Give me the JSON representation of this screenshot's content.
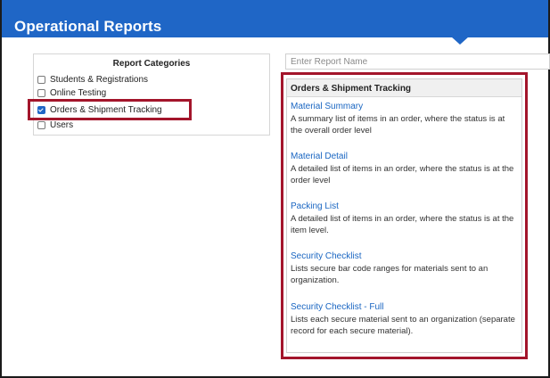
{
  "header": {
    "title": "Operational Reports",
    "color": "#1f66c6"
  },
  "categories": {
    "title": "Report Categories",
    "items": [
      {
        "label": "Students & Registrations",
        "checked": false
      },
      {
        "label": "Online Testing",
        "checked": false
      },
      {
        "label": "Orders & Shipment Tracking",
        "checked": true
      },
      {
        "label": "Users",
        "checked": false
      }
    ]
  },
  "search": {
    "placeholder": "Enter Report Name"
  },
  "reports": {
    "heading": "Orders & Shipment Tracking",
    "items": [
      {
        "name": "Material Summary",
        "description": "A summary list of items in an order, where the status is at the overall order level"
      },
      {
        "name": "Material Detail",
        "description": "A detailed list of items in an order, where the status is at the order level"
      },
      {
        "name": "Packing List",
        "description": "A detailed list of items in an order, where the status is at the item level."
      },
      {
        "name": "Security Checklist",
        "description": "Lists secure bar code ranges for materials sent to an organization."
      },
      {
        "name": "Security Checklist - Full",
        "description": "Lists each secure material sent to an organization (separate record for each secure material)."
      }
    ]
  },
  "colors": {
    "highlight": "#a3152b",
    "link": "#1a66c2"
  }
}
